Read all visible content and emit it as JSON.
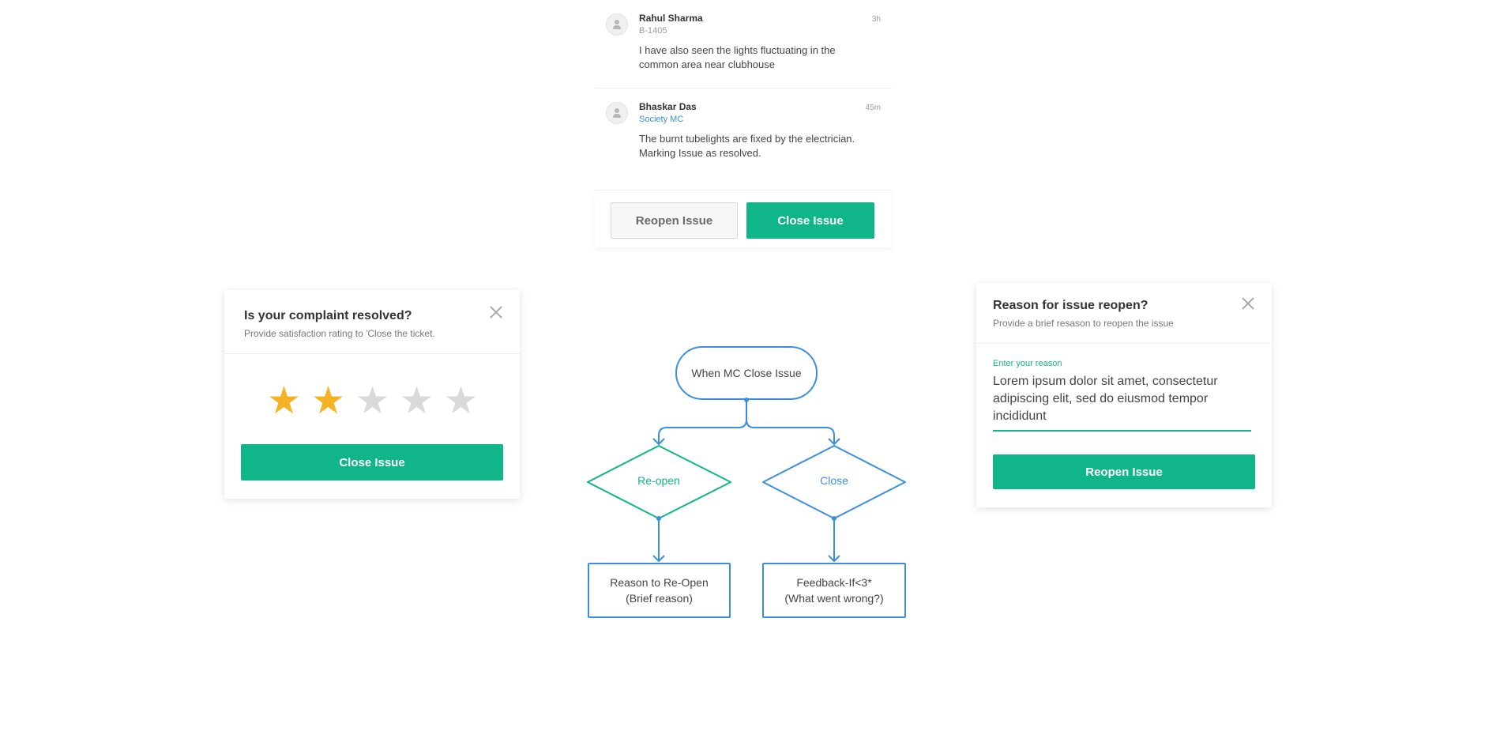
{
  "comments": [
    {
      "name": "Rahul Sharma",
      "sub": "B-1405",
      "time": "3h",
      "text": "I have also seen the lights fluctuating in the common area near clubhouse"
    },
    {
      "name": "Bhaskar Das",
      "sub": "Society MC",
      "time": "45m",
      "text": "The burnt tubelights are fixed by the electrician. Marking Issue as resolved."
    }
  ],
  "action_bar": {
    "reopen_label": "Reopen Issue",
    "close_label": "Close Issue"
  },
  "rating_modal": {
    "title": "Is your complaint resolved?",
    "subtitle": "Provide satisfaction rating to 'Close the ticket.",
    "rating": 2,
    "max_rating": 5,
    "submit_label": "Close Issue"
  },
  "reopen_modal": {
    "title": "Reason for issue reopen?",
    "subtitle": "Provide a brief resason to reopen the issue",
    "field_label": "Enter your reason",
    "field_value": "Lorem ipsum dolor sit amet, consectetur adipiscing elit, sed do eiusmod tempor incididunt",
    "submit_label": "Reopen Issue"
  },
  "flowchart": {
    "start": "When MC Close Issue",
    "branch_left": "Re-open",
    "branch_right": "Close",
    "result_left_line1": "Reason to Re-Open",
    "result_left_line2": "(Brief reason)",
    "result_right_line1": "Feedback-If<3*",
    "result_right_line2": "(What went wrong?)"
  },
  "colors": {
    "accent_green": "#11b58a",
    "accent_blue": "#3a8fe3",
    "star_active": "#f5b323",
    "star_inactive": "#d9d9d9"
  },
  "icons": {
    "close": "close-icon",
    "avatar": "avatar-icon",
    "star": "star-icon"
  }
}
